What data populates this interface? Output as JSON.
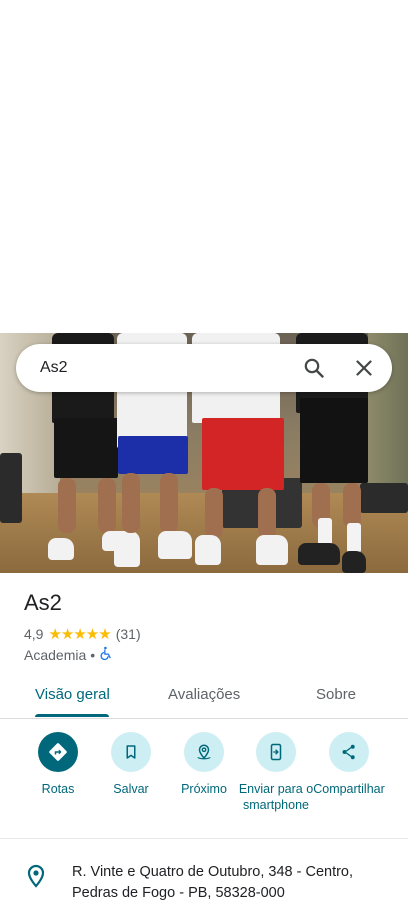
{
  "search": {
    "query": "As2"
  },
  "place": {
    "name": "As2",
    "rating": "4,9",
    "stars": "★★★★★",
    "review_count": "(31)",
    "category": "Academia",
    "separator": "•"
  },
  "tabs": [
    {
      "label": "Visão geral"
    },
    {
      "label": "Avaliações"
    },
    {
      "label": "Sobre"
    }
  ],
  "actions": [
    {
      "label": "Rotas"
    },
    {
      "label": "Salvar"
    },
    {
      "label": "Próximo"
    },
    {
      "label": "Enviar para o smartphone"
    },
    {
      "label": "Compartilhar"
    }
  ],
  "address": {
    "line1": "R. Vinte e Quatro de Outubro, 348 - Centro,",
    "line2": "Pedras de Fogo - PB, 58328-000"
  },
  "colors": {
    "accent": "#00687a",
    "action_bg": "#cdeef3",
    "stars": "#fbbc04"
  },
  "icons": {
    "search": "search-icon",
    "close": "close-icon",
    "directions": "directions-icon",
    "save": "bookmark-icon",
    "nearby": "nearby-icon",
    "send": "send-to-phone-icon",
    "share": "share-icon",
    "wheelchair": "wheelchair-icon",
    "location": "location-pin-icon"
  }
}
